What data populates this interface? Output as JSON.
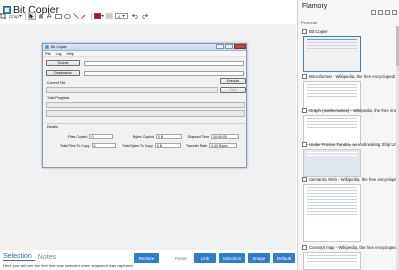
{
  "app": {
    "title": "Bit Copier"
  },
  "toolbar": {
    "crop_label": "Crop",
    "text_tool": "A",
    "zoom_label": "4",
    "accent": "#e00000"
  },
  "window": {
    "title": "Bit Copier",
    "menu": [
      "File",
      "Log",
      "Help"
    ],
    "source_button": "Source",
    "destination_button": "Destination",
    "execute_button": "Execute",
    "stop_button": "Stop",
    "current_file_label": "Current File",
    "total_progress_label": "Total Progress",
    "details_label": "Details",
    "files_copied_label": "Files Copied",
    "files_copied_value": "0",
    "total_files_label": "Total Files To Copy",
    "total_files_value": "0",
    "bytes_copied_label": "Bytes Copied",
    "bytes_copied_value": "0 B",
    "total_bytes_label": "Total Bytes To Copy",
    "total_bytes_value": "0 B",
    "elapsed_label": "Elapsed Time",
    "elapsed_value": "00:00:00",
    "transfer_label": "Transfer Rate",
    "transfer_value": "0.00 B/sec"
  },
  "bottom": {
    "tabs": [
      "Selection",
      "Notes"
    ],
    "note_text": "Here you will see the text that was selected when snapshot was captured.",
    "restore_button": "Restore",
    "paste_label": "Paste:",
    "link_button": "Link",
    "selection_button": "Selection",
    "image_button": "Image",
    "default_button": "Default"
  },
  "sidebar": {
    "title": "Flamory",
    "section_label": "Personal",
    "items": [
      {
        "title": "Bit Copier"
      },
      {
        "title": "Microformat - Wikipedia, the free encyclopedi"
      },
      {
        "title": "Graph (mathematics) - Wikipedia, the free encyclo"
      },
      {
        "title": "Under Frozen Tundra, an Icebreaking Ship Unco"
      },
      {
        "title": "Semantic Web - Wikipedia, the free encyclopedi"
      },
      {
        "title": "Concept map - Wikipedia, the free encyclopedi"
      }
    ]
  }
}
